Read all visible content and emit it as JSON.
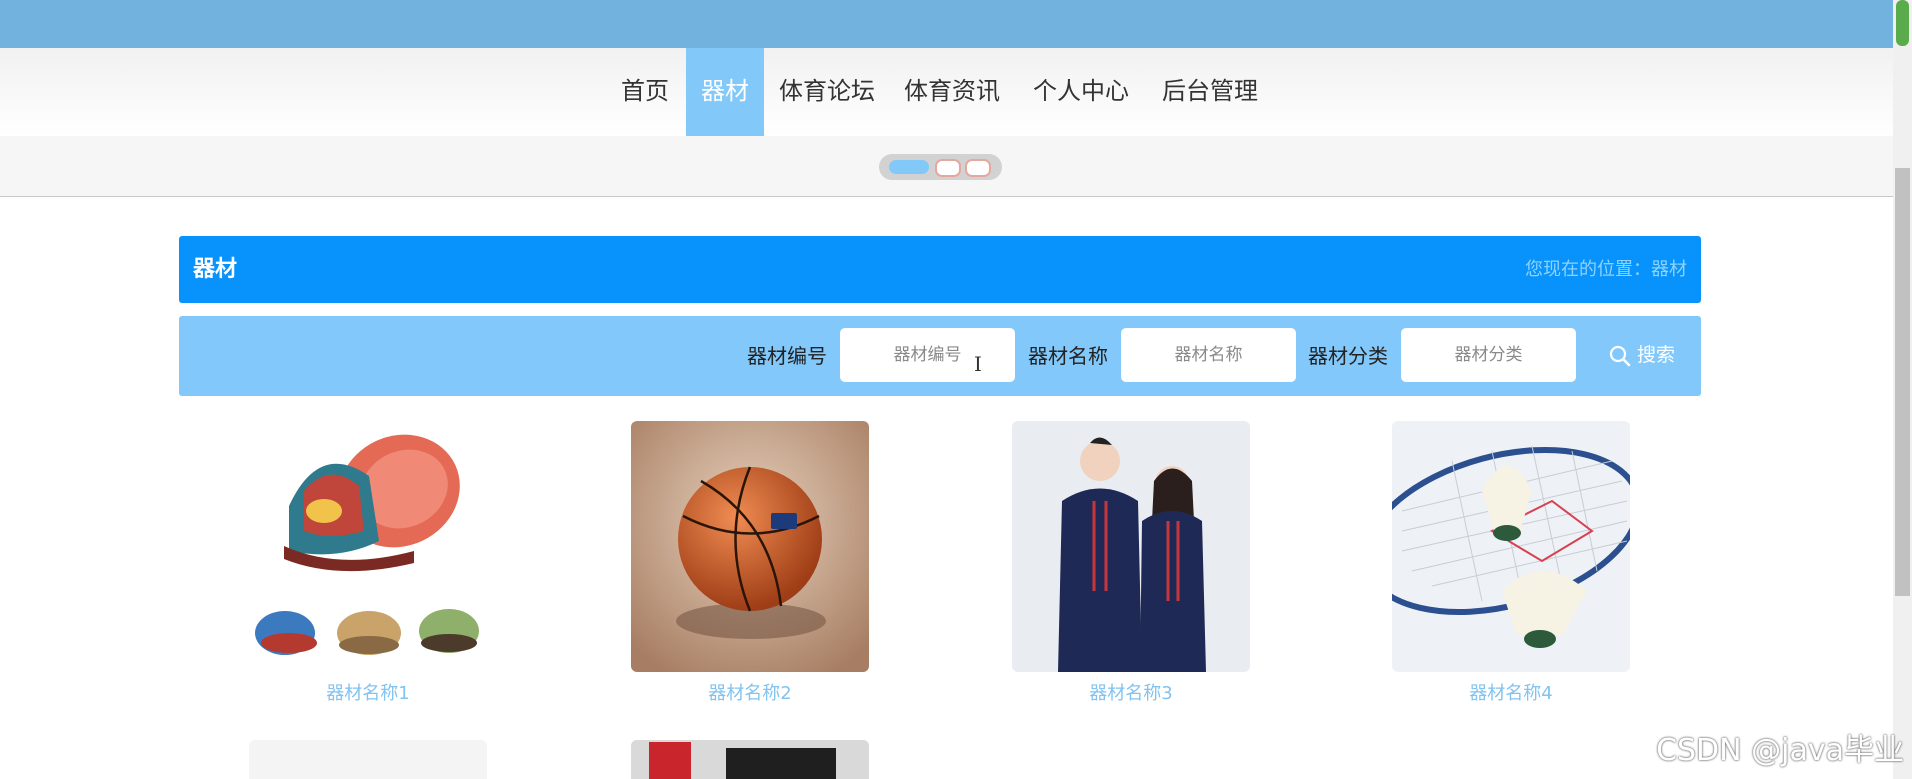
{
  "nav": {
    "items": [
      {
        "label": "首页"
      },
      {
        "label": "器材"
      },
      {
        "label": "体育论坛"
      },
      {
        "label": "体育资讯"
      },
      {
        "label": "个人中心"
      },
      {
        "label": "后台管理"
      }
    ],
    "active_index": 1
  },
  "carousel": {
    "count": 3,
    "active": 0
  },
  "section": {
    "title": "器材",
    "breadcrumb": "您现在的位置：器材"
  },
  "search": {
    "fields": [
      {
        "label": "器材编号",
        "placeholder": "器材编号"
      },
      {
        "label": "器材名称",
        "placeholder": "器材名称"
      },
      {
        "label": "器材分类",
        "placeholder": "器材分类"
      }
    ],
    "button_label": "搜索"
  },
  "products": [
    {
      "name": "器材名称1",
      "image": "basketball-shoes"
    },
    {
      "name": "器材名称2",
      "image": "basketball"
    },
    {
      "name": "器材名称3",
      "image": "tracksuits"
    },
    {
      "name": "器材名称4",
      "image": "badminton"
    }
  ],
  "watermark": "CSDN @java毕业",
  "colors": {
    "topbar": "#72b2df",
    "nav_active": "#82c8f8",
    "title_bar": "#0892fb",
    "search_bar": "#82c8fa",
    "product_name": "#82c3ef"
  }
}
